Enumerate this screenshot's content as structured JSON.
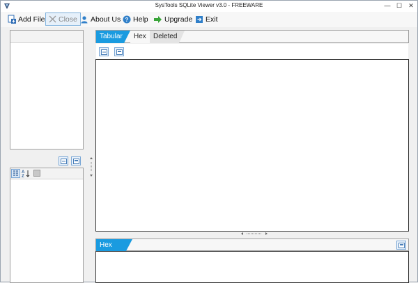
{
  "window": {
    "title": "SysTools SQLite Viewer  v3.0 - FREEWARE",
    "controls": {
      "minimize": "—",
      "maximize": "☐",
      "close": "✕"
    }
  },
  "toolbar": {
    "add_file": "Add File",
    "close": "Close",
    "about_us": "About Us",
    "help": "Help",
    "upgrade": "Upgrade",
    "exit": "Exit"
  },
  "main": {
    "tabs": [
      {
        "label": "Tabular",
        "active": true
      },
      {
        "label": "Hex",
        "active": false
      },
      {
        "label": "Deleted",
        "active": false
      }
    ]
  },
  "hex_panel": {
    "label": "Hex"
  },
  "colors": {
    "accent": "#1a9be0",
    "border": "#a0a0a0",
    "toolbar_active": "#e6f0fa"
  }
}
